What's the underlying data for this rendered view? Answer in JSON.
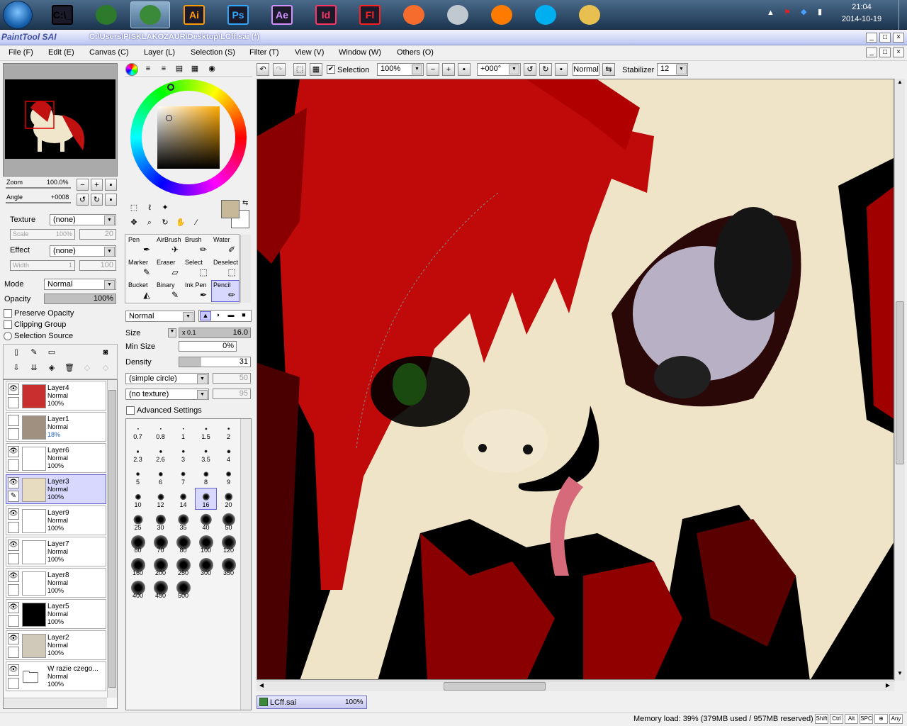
{
  "taskbar": {
    "apps": [
      {
        "name": "cmd",
        "label": "C:\\_",
        "icon": "terminal-icon",
        "color": "#000000"
      },
      {
        "name": "computer",
        "label": "",
        "icon": "computer-icon",
        "color": "#2d7a2d"
      },
      {
        "name": "paint-tool-sai",
        "label": "",
        "icon": "sai-icon",
        "color": "#3a8a3a"
      },
      {
        "name": "illustrator",
        "label": "Ai",
        "icon": "illustrator-icon",
        "color": "#ff9a00"
      },
      {
        "name": "photoshop",
        "label": "Ps",
        "icon": "photoshop-icon",
        "color": "#31a8ff"
      },
      {
        "name": "after-effects",
        "label": "Ae",
        "icon": "after-effects-icon",
        "color": "#d291ff"
      },
      {
        "name": "indesign",
        "label": "Id",
        "icon": "indesign-icon",
        "color": "#ff3366"
      },
      {
        "name": "flash",
        "label": "Fl",
        "icon": "flash-icon",
        "color": "#ff2020"
      },
      {
        "name": "origin",
        "label": "",
        "icon": "origin-icon",
        "color": "#f56c2d"
      },
      {
        "name": "steam",
        "label": "",
        "icon": "steam-icon",
        "color": "#c0c8d0"
      },
      {
        "name": "firefox",
        "label": "",
        "icon": "firefox-icon",
        "color": "#ff7b00"
      },
      {
        "name": "skype",
        "label": "",
        "icon": "skype-icon",
        "color": "#00aff0"
      },
      {
        "name": "explorer",
        "label": "",
        "icon": "folder-icon",
        "color": "#e8c050"
      }
    ],
    "clock_time": "21:04",
    "clock_date": "2014-10-19"
  },
  "window": {
    "app_name": "PaintTool SAI",
    "title": "C:\\Users\\PISKLAKOZAUR\\Desktop\\LCff.sai (*)"
  },
  "menu": [
    "File (F)",
    "Edit (E)",
    "Canvas (C)",
    "Layer (L)",
    "Selection (S)",
    "Filter (T)",
    "View (V)",
    "Window (W)",
    "Others (O)"
  ],
  "navigator": {
    "zoom_label": "Zoom",
    "zoom_value": "100.0%",
    "angle_label": "Angle",
    "angle_value": "+0008"
  },
  "texture": {
    "texture_label": "Texture",
    "texture_value": "(none)",
    "scale_label": "Scale",
    "scale_value": "100%",
    "scale_num": "20",
    "effect_label": "Effect",
    "effect_value": "(none)",
    "width_label": "Width",
    "width_value": "1",
    "width_num": "100"
  },
  "layer_props": {
    "mode_label": "Mode",
    "mode_value": "Normal",
    "opacity_label": "Opacity",
    "opacity_value": "100%",
    "preserve_opacity": "Preserve Opacity",
    "clipping_group": "Clipping Group",
    "selection_source": "Selection Source"
  },
  "layers": [
    {
      "name": "Layer4",
      "mode": "Normal",
      "opacity": "100%",
      "visible": true,
      "selected": false,
      "thumb": "#c83030"
    },
    {
      "name": "Layer1",
      "mode": "Normal",
      "opacity": "18%",
      "visible": false,
      "selected": false,
      "thumb": "#a09080"
    },
    {
      "name": "Layer6",
      "mode": "Normal",
      "opacity": "100%",
      "visible": true,
      "selected": false,
      "thumb": "#ffffff"
    },
    {
      "name": "Layer3",
      "mode": "Normal",
      "opacity": "100%",
      "visible": true,
      "selected": true,
      "thumb": "#e8dcc0"
    },
    {
      "name": "Layer9",
      "mode": "Normal",
      "opacity": "100%",
      "visible": true,
      "selected": false,
      "thumb": "#ffffff"
    },
    {
      "name": "Layer7",
      "mode": "Normal",
      "opacity": "100%",
      "visible": true,
      "selected": false,
      "thumb": "#ffffff"
    },
    {
      "name": "Layer8",
      "mode": "Normal",
      "opacity": "100%",
      "visible": true,
      "selected": false,
      "thumb": "#ffffff"
    },
    {
      "name": "Layer5",
      "mode": "Normal",
      "opacity": "100%",
      "visible": true,
      "selected": false,
      "thumb": "#000000"
    },
    {
      "name": "Layer2",
      "mode": "Normal",
      "opacity": "100%",
      "visible": true,
      "selected": false,
      "thumb": "#d0c8b8"
    },
    {
      "name": "W razie czego...",
      "mode": "Normal",
      "opacity": "100%",
      "visible": true,
      "selected": false,
      "thumb": "folder"
    }
  ],
  "color": {
    "primary": "#c8b89a"
  },
  "tools": [
    {
      "label": "Pen",
      "icon": "pen-icon"
    },
    {
      "label": "AirBrush",
      "icon": "airbrush-icon"
    },
    {
      "label": "Brush",
      "icon": "brush-icon"
    },
    {
      "label": "Water",
      "icon": "water-icon"
    },
    {
      "label": "Marker",
      "icon": "marker-icon"
    },
    {
      "label": "Eraser",
      "icon": "eraser-icon"
    },
    {
      "label": "Select",
      "icon": "select-icon"
    },
    {
      "label": "Deselect",
      "icon": "deselect-icon"
    },
    {
      "label": "Bucket",
      "icon": "bucket-icon"
    },
    {
      "label": "Binary",
      "icon": "binary-icon"
    },
    {
      "label": "Ink Pen",
      "icon": "ink-pen-icon"
    },
    {
      "label": "Pencil",
      "icon": "pencil-icon",
      "selected": true
    }
  ],
  "brush": {
    "blend_mode": "Normal",
    "size_label": "Size",
    "size_mult": "x 0.1",
    "size_value": "16.0",
    "min_size_label": "Min Size",
    "min_size_value": "0%",
    "density_label": "Density",
    "density_value": "31",
    "shape": "(simple circle)",
    "shape_value": "50",
    "texture": "(no texture)",
    "texture_value": "95",
    "advanced": "Advanced Settings"
  },
  "brush_sizes": [
    "0.7",
    "0.8",
    "1",
    "1.5",
    "2",
    "2.3",
    "2.6",
    "3",
    "3.5",
    "4",
    "5",
    "6",
    "7",
    "8",
    "9",
    "10",
    "12",
    "14",
    "16",
    "20",
    "25",
    "30",
    "35",
    "40",
    "50",
    "60",
    "70",
    "80",
    "100",
    "120",
    "160",
    "200",
    "250",
    "300",
    "350",
    "400",
    "450",
    "500"
  ],
  "selected_brush_size": "16",
  "canvas_toolbar": {
    "selection_label": "Selection",
    "zoom_value": "100%",
    "angle_value": "+000°",
    "blend_value": "Normal",
    "stabilizer_label": "Stabilizer",
    "stabilizer_value": "12"
  },
  "doc_tab": {
    "name": "LCff.sai",
    "zoom": "100%"
  },
  "status": {
    "memory": "Memory load: 39% (379MB used / 957MB reserved)",
    "keys": [
      "Shift",
      "Ctrl",
      "Alt",
      "SPC",
      "⊕",
      "Any"
    ]
  }
}
